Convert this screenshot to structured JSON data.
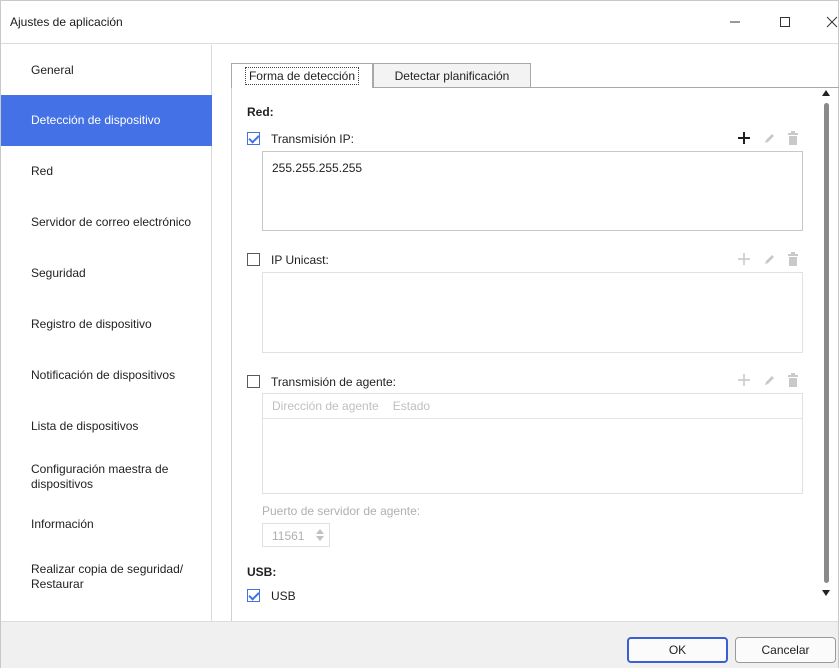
{
  "window": {
    "title": "Ajustes de aplicación"
  },
  "sidebar": {
    "items": [
      {
        "label": "General"
      },
      {
        "label": "Detección de dispositivo",
        "active": true
      },
      {
        "label": "Red"
      },
      {
        "label": "Servidor de correo electrónico"
      },
      {
        "label": "Seguridad"
      },
      {
        "label": "Registro de dispositivo"
      },
      {
        "label": "Notificación de dispositivos"
      },
      {
        "label": "Lista de dispositivos"
      },
      {
        "label": "Configuración maestra de dispositivos"
      },
      {
        "label": "Información"
      },
      {
        "label": "Realizar copia de seguridad/ Restaurar"
      }
    ]
  },
  "tabs": [
    {
      "label": "Forma de detección",
      "active": true
    },
    {
      "label": "Detectar planificación",
      "active": false
    }
  ],
  "network": {
    "heading": "Red:",
    "ip_broadcast": {
      "label": "Transmisión IP:",
      "checked": true,
      "values": [
        "255.255.255.255"
      ]
    },
    "ip_unicast": {
      "label": "IP Unicast:",
      "checked": false
    },
    "agent_broadcast": {
      "label": "Transmisión de agente:",
      "checked": false,
      "columns": [
        "Dirección de agente",
        "Estado"
      ]
    },
    "agent_port": {
      "label": "Puerto de servidor de agente:",
      "value": "11561"
    }
  },
  "usb": {
    "heading": "USB:",
    "usb_option": {
      "label": "USB",
      "checked": true
    }
  },
  "footer": {
    "ok_label": "OK",
    "cancel_label": "Cancelar"
  },
  "colors": {
    "accent": "#4472e6",
    "ok_border": "#3a5fd0",
    "disabled_text": "#b0b0b0"
  },
  "icons": {
    "add": "plus-icon",
    "edit": "pencil-icon",
    "delete": "trash-icon"
  }
}
